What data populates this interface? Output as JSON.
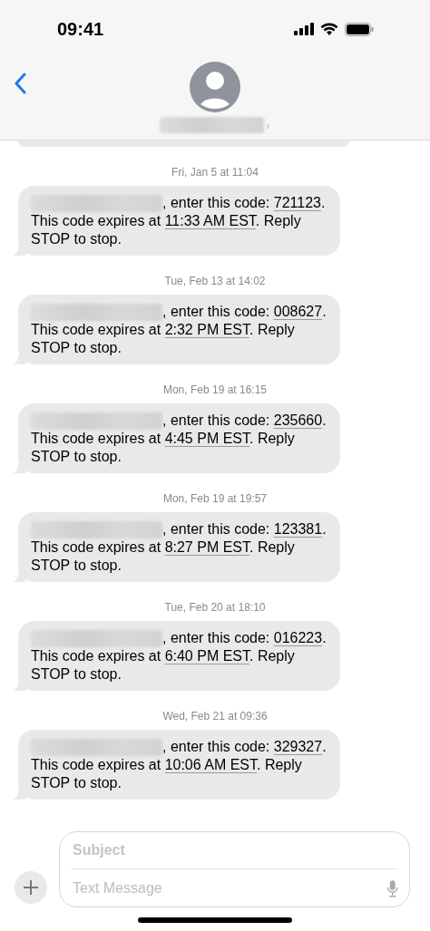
{
  "status_bar": {
    "time": "09:41"
  },
  "header": {
    "contact_chevron": "›"
  },
  "messages": [
    {
      "timestamp": "Fri, Jan 5 at 11:04",
      "text_a": ", enter this code: ",
      "code": "721123",
      "text_b": ". This code expires at ",
      "expiry": "11:33 AM EST",
      "text_c": ". Reply STOP to stop."
    },
    {
      "timestamp": "Tue, Feb 13 at 14:02",
      "text_a": ", enter this code: ",
      "code": "008627",
      "text_b": ". This code expires at ",
      "expiry": "2:32 PM EST",
      "text_c": ". Reply STOP to stop."
    },
    {
      "timestamp": "Mon, Feb 19 at 16:15",
      "text_a": ", enter this code: ",
      "code": "235660",
      "text_b": ". This code expires at ",
      "expiry": "4:45 PM EST",
      "text_c": ". Reply STOP to stop."
    },
    {
      "timestamp": "Mon, Feb 19 at 19:57",
      "text_a": ", enter this code: ",
      "code": "123381",
      "text_b": ". This code expires at ",
      "expiry": "8:27 PM EST",
      "text_c": ". Reply STOP to stop."
    },
    {
      "timestamp": "Tue, Feb 20 at 18:10",
      "text_a": ", enter this code: ",
      "code": "016223",
      "text_b": ". This code expires at ",
      "expiry": "6:40 PM EST",
      "text_c": ". Reply STOP to stop."
    },
    {
      "timestamp": "Wed, Feb 21 at 09:36",
      "text_a": ", enter this code: ",
      "code": "329327",
      "text_b": ". This code expires at ",
      "expiry": "10:06 AM EST",
      "text_c": ". Reply STOP to stop."
    }
  ],
  "composer": {
    "subject_placeholder": "Subject",
    "message_placeholder": "Text Message"
  }
}
